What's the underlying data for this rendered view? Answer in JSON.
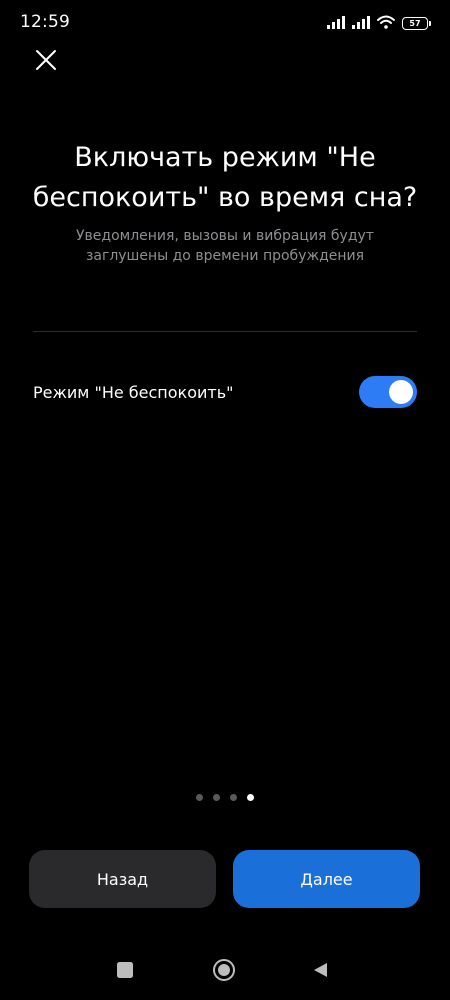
{
  "status_bar": {
    "time": "12:59",
    "battery_level": "57",
    "icons": [
      "signal-icon",
      "signal-icon",
      "wifi-icon",
      "battery-icon"
    ]
  },
  "header": {
    "close_icon": "close-icon"
  },
  "main": {
    "title_line1": "Включать режим \"Не",
    "title_line2": "беспокоить\" во время сна?",
    "subtitle_line1": "Уведомления, вызовы и вибрация будут",
    "subtitle_line2": "заглушены до времени пробуждения",
    "setting": {
      "label": "Режим \"Не беспокоить\"",
      "enabled": true
    }
  },
  "pagination": {
    "total": 4,
    "current": 4
  },
  "buttons": {
    "back_label": "Назад",
    "next_label": "Далее"
  },
  "nav_bar": {
    "icons": [
      "recents-square-icon",
      "home-circle-icon",
      "back-triangle-icon"
    ]
  },
  "colors": {
    "background": "#000000",
    "accent": "#1a6fd8",
    "toggle_on": "#2d7cf6",
    "secondary_text": "#8e8e93",
    "back_button": "#2a2a2c"
  }
}
